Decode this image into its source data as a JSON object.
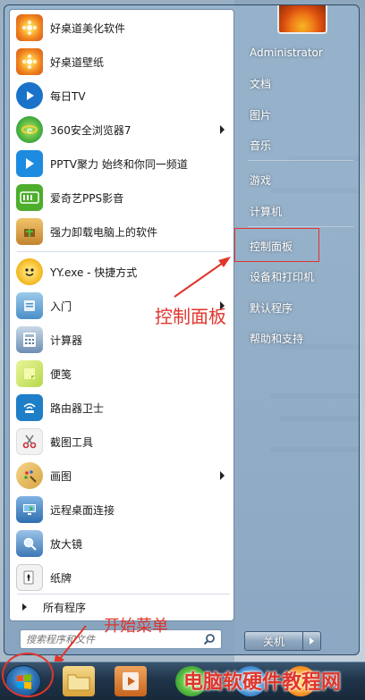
{
  "start_menu": {
    "pinned": [
      {
        "label": "好桌道美化软件",
        "icon": "flower-icon",
        "color": "#f0821e"
      },
      {
        "label": "好桌道壁纸",
        "icon": "flower-icon",
        "color": "#f0821e"
      },
      {
        "label": "每日TV",
        "icon": "play-icon",
        "color": "#1a73c9"
      },
      {
        "label": "360安全浏览器7",
        "icon": "browser-360-icon",
        "color": "#3aa63a",
        "submenu": true
      },
      {
        "label": "PPTV聚力 始终和你同一频道",
        "icon": "pptv-icon",
        "color": "#1d8be0"
      },
      {
        "label": "爱奇艺PPS影音",
        "icon": "iqiyi-icon",
        "color": "#4cae2c"
      },
      {
        "label": "强力卸载电脑上的软件",
        "icon": "uninstall-box-icon",
        "color": "#d79a3c"
      }
    ],
    "recent": [
      {
        "label": "YY.exe - 快捷方式",
        "icon": "yy-icon",
        "color": "#f2b51c"
      },
      {
        "label": "入门",
        "icon": "getting-started-icon",
        "color": "#4a90c8",
        "submenu": true
      },
      {
        "label": "计算器",
        "icon": "calculator-icon",
        "color": "#6d8fb3"
      },
      {
        "label": "便笺",
        "icon": "sticky-notes-icon",
        "color": "#b8d84a"
      },
      {
        "label": "路由器卫士",
        "icon": "router-icon",
        "color": "#1e7ec8"
      },
      {
        "label": "截图工具",
        "icon": "scissors-icon",
        "color": "#c8323c"
      },
      {
        "label": "画图",
        "icon": "paint-icon",
        "color": "#d9a441",
        "submenu": true
      },
      {
        "label": "远程桌面连接",
        "icon": "remote-desktop-icon",
        "color": "#2e6fb0"
      },
      {
        "label": "放大镜",
        "icon": "magnifier-icon",
        "color": "#3c78b4"
      },
      {
        "label": "纸牌",
        "icon": "cards-icon",
        "color": "#666666"
      }
    ],
    "all_programs": "所有程序",
    "search_placeholder": "搜索程序和文件",
    "right_items": [
      "Administrator",
      "文档",
      "图片",
      "音乐",
      "游戏",
      "计算机",
      "控制面板",
      "设备和打印机",
      "默认程序",
      "帮助和支持"
    ],
    "shutdown_label": "关机"
  },
  "annotations": {
    "control_panel": "控制面板",
    "start_menu": "开始菜单",
    "watermark": "电脑软硬件教程网",
    "color": "#e0352b"
  }
}
